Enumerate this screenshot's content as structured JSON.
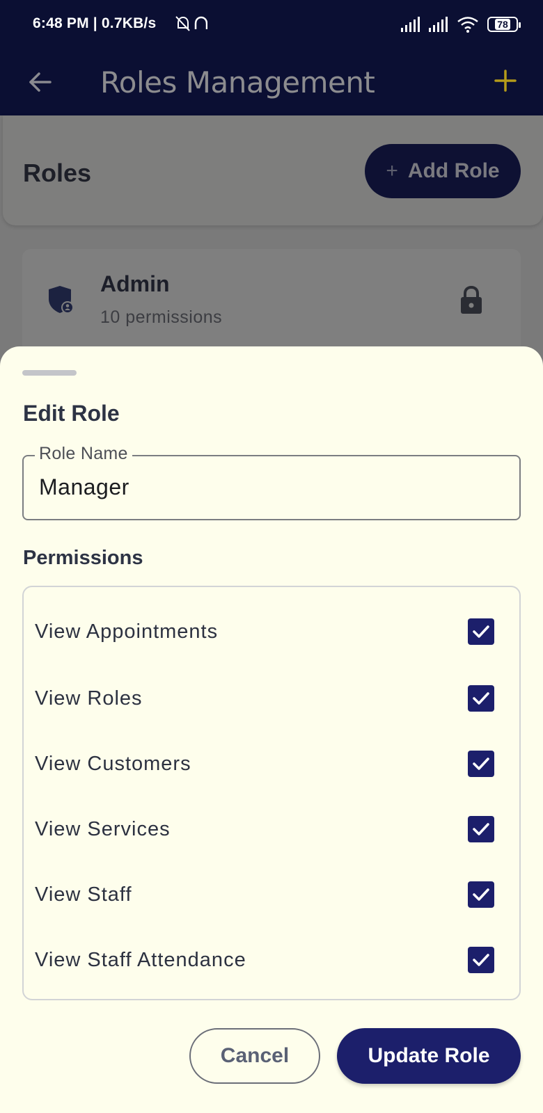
{
  "status_bar": {
    "time": "6:48 PM | 0.7KB/s",
    "battery": "78"
  },
  "app_bar": {
    "title": "Roles Management",
    "back_icon": "arrow-left-icon",
    "add_icon": "plus-icon",
    "add_icon_color": "#c2a30f"
  },
  "roles_header": {
    "title": "Roles",
    "add_button_label": "Add Role"
  },
  "role_list": [
    {
      "name": "Admin",
      "permissions_text": "10 permissions",
      "icon": "shield-user-icon",
      "locked": true
    }
  ],
  "sheet": {
    "title": "Edit Role",
    "role_name_label": "Role Name",
    "role_name_value": "Manager",
    "permissions_heading": "Permissions",
    "permissions": [
      {
        "label": "View Appointments",
        "checked": true
      },
      {
        "label": "View Roles",
        "checked": true
      },
      {
        "label": "View Customers",
        "checked": true
      },
      {
        "label": "View Services",
        "checked": true
      },
      {
        "label": "View Staff",
        "checked": true
      },
      {
        "label": "View Staff Attendance",
        "checked": true
      }
    ],
    "cancel_label": "Cancel",
    "update_label": "Update Role"
  },
  "colors": {
    "primary": "#1c1f6b",
    "app_bar": "#0b0f33",
    "sheet_bg": "#fefeec",
    "text_dark": "#2d3344"
  }
}
